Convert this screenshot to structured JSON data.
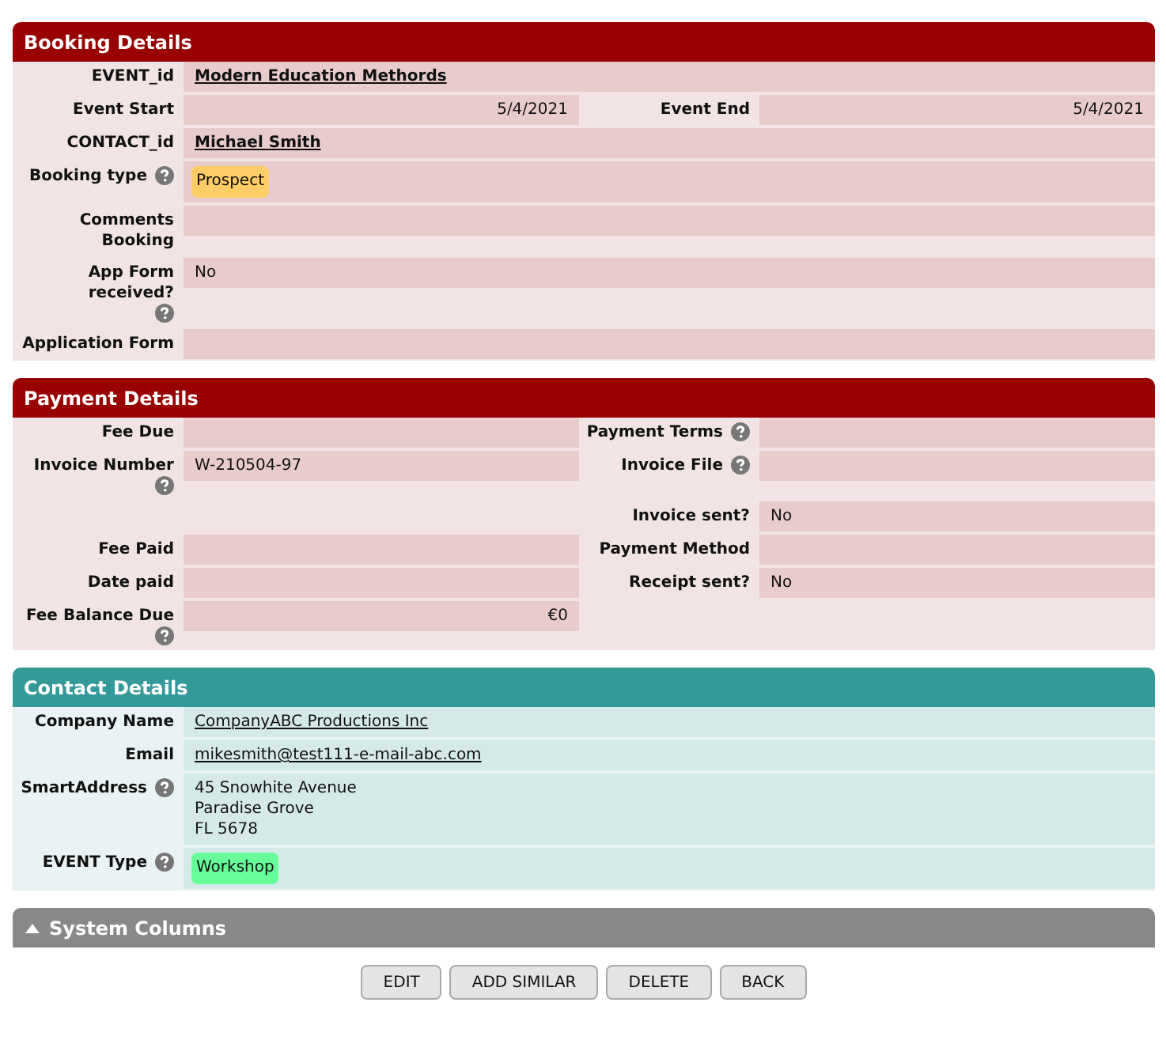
{
  "sections": [
    {
      "title": "Booking Details",
      "color": "#990000",
      "rows": [
        {
          "fields": [
            {
              "label": "EVENT_id",
              "help": false,
              "kind": "ref",
              "value": "Modern Education Methords"
            }
          ]
        },
        {
          "fields": [
            {
              "label": "Event Start",
              "help": false,
              "kind": "amount",
              "value": "5/4/2021"
            },
            {
              "label": "Event End",
              "help": false,
              "kind": "amount",
              "value": "5/4/2021"
            }
          ]
        },
        {
          "fields": [
            {
              "label": "CONTACT_id",
              "help": false,
              "kind": "ref",
              "value": "Michael Smith"
            }
          ]
        },
        {
          "fields": [
            {
              "label": "Booking type",
              "help": true,
              "kind": "tag",
              "value": "Prospect",
              "color": "#ffcc66"
            }
          ]
        },
        {
          "fields": [
            {
              "label": "Comments Booking",
              "help": false,
              "kind": "text"
            }
          ]
        },
        {
          "fields": [
            {
              "label": "App Form received?",
              "help": true,
              "kind": "text",
              "value": "No"
            }
          ]
        },
        {
          "fields": [
            {
              "label": "Application Form",
              "help": false,
              "kind": "text"
            }
          ]
        }
      ]
    },
    {
      "title": "Payment Details",
      "color": "#990000",
      "rows": [
        {
          "fields": [
            {
              "label": "Fee Due",
              "help": false,
              "kind": "text"
            },
            {
              "label": "Payment Terms",
              "help": true,
              "kind": "text"
            }
          ]
        },
        {
          "fields": [
            {
              "label": "Invoice Number",
              "help": true,
              "kind": "text",
              "value": "W-210504-97"
            },
            {
              "label": "Invoice File",
              "help": true,
              "kind": "text"
            }
          ]
        },
        {
          "fields": [
            {
              "kind": "blank"
            },
            {
              "label": "Invoice sent?",
              "help": false,
              "kind": "text",
              "value": "No"
            }
          ]
        },
        {
          "fields": [
            {
              "label": "Fee Paid",
              "help": false,
              "kind": "text"
            },
            {
              "label": "Payment Method",
              "help": false,
              "kind": "text"
            }
          ]
        },
        {
          "fields": [
            {
              "label": "Date paid",
              "help": false,
              "kind": "text"
            },
            {
              "label": "Receipt sent?",
              "help": false,
              "kind": "text",
              "value": "No"
            }
          ]
        },
        {
          "fields": [
            {
              "label": "Fee Balance Due",
              "help": true,
              "kind": "amount",
              "value": "€0"
            },
            {
              "kind": "blank"
            }
          ]
        }
      ]
    },
    {
      "title": "Contact Details",
      "color": "#339999",
      "rows": [
        {
          "fields": [
            {
              "label": "Company Name",
              "help": false,
              "kind": "link",
              "value": "CompanyABC Productions Inc"
            }
          ]
        },
        {
          "fields": [
            {
              "label": "Email",
              "help": false,
              "kind": "link",
              "value": "mikesmith@test111-e-mail-abc.com"
            }
          ]
        },
        {
          "fields": [
            {
              "label": "SmartAddress",
              "help": true,
              "kind": "address",
              "lines": [
                "45 Snowhite Avenue",
                "Paradise Grove",
                "FL 5678"
              ]
            }
          ]
        },
        {
          "fields": [
            {
              "label": "EVENT Type",
              "help": true,
              "kind": "tag",
              "value": "Workshop",
              "color": "#66ff99"
            }
          ]
        }
      ]
    }
  ],
  "system_columns": {
    "title": "System Columns"
  },
  "buttons": [
    "EDIT",
    "ADD SIMILAR",
    "DELETE",
    "BACK"
  ]
}
